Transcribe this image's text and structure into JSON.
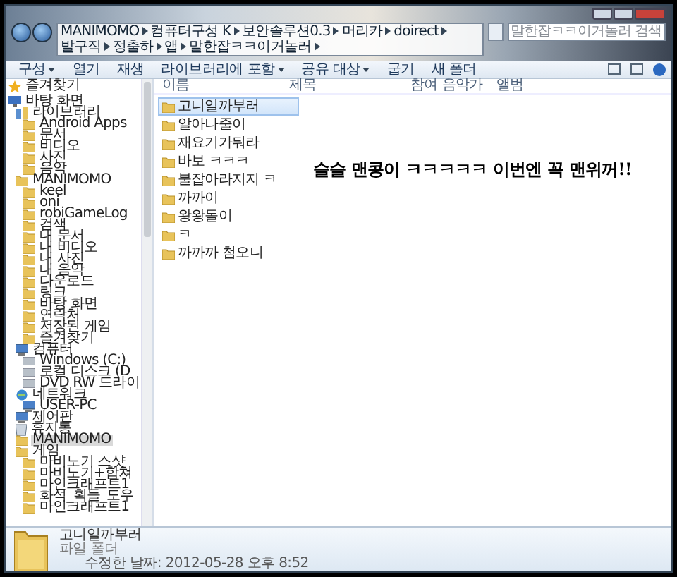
{
  "address_bar": {
    "path": [
      "MANIMOMO",
      "컴퓨터구성 K",
      "보안솔루션0.3",
      "머리카",
      "doirect",
      "발구직",
      "정출하",
      "앱",
      "말한잡ㅋㅋ이거놀러"
    ]
  },
  "search": {
    "placeholder": "말한잡ㅋㅋ이거놀러 검색"
  },
  "toolbar": [
    {
      "label": "구성",
      "dropdown": true
    },
    {
      "label": "열기",
      "dropdown": false
    },
    {
      "label": "재생",
      "dropdown": false
    },
    {
      "label": "라이브러리에 포함",
      "dropdown": true
    },
    {
      "label": "공유 대상",
      "dropdown": true
    },
    {
      "label": "굽기",
      "dropdown": false
    },
    {
      "label": "새 폴더",
      "dropdown": false
    }
  ],
  "sidebar": {
    "items": [
      {
        "label": "즐겨찾기",
        "kind": "star",
        "selected": false
      },
      {
        "label": "바탕 화면",
        "kind": "desktop",
        "selected": false,
        "children": [
          {
            "label": "라이브러리",
            "kind": "library",
            "selected": false,
            "children": [
              {
                "label": "Android Apps",
                "kind": "folder",
                "selected": false
              },
              {
                "label": "문서",
                "kind": "folder",
                "selected": false
              },
              {
                "label": "비디오",
                "kind": "folder",
                "selected": false
              },
              {
                "label": "사진",
                "kind": "folder",
                "selected": false
              },
              {
                "label": "음악",
                "kind": "folder",
                "selected": false
              }
            ]
          },
          {
            "label": "MANIMOMO",
            "kind": "folder",
            "selected": false,
            "children": [
              {
                "label": "keel",
                "kind": "folder",
                "selected": false
              },
              {
                "label": "oni",
                "kind": "folder",
                "selected": false
              },
              {
                "label": "robiGameLog",
                "kind": "folder",
                "selected": false
              },
              {
                "label": "검색",
                "kind": "folder",
                "selected": false
              },
              {
                "label": "내 문서",
                "kind": "folder",
                "selected": false
              },
              {
                "label": "내 비디오",
                "kind": "folder",
                "selected": false
              },
              {
                "label": "내 사진",
                "kind": "folder",
                "selected": false
              },
              {
                "label": "내 음악",
                "kind": "folder",
                "selected": false
              },
              {
                "label": "다운로드",
                "kind": "folder",
                "selected": false
              },
              {
                "label": "링크",
                "kind": "folder",
                "selected": false
              },
              {
                "label": "바탕 화면",
                "kind": "folder",
                "selected": false
              },
              {
                "label": "연락처",
                "kind": "folder",
                "selected": false
              },
              {
                "label": "저장된 게임",
                "kind": "folder",
                "selected": false
              },
              {
                "label": "즐겨찾기",
                "kind": "folder",
                "selected": false
              }
            ]
          },
          {
            "label": "컴퓨터",
            "kind": "computer",
            "selected": false,
            "children": [
              {
                "label": "Windows (C:)",
                "kind": "drive",
                "selected": false
              },
              {
                "label": "로컬 디스크 (D",
                "kind": "drive",
                "selected": false
              },
              {
                "label": "DVD RW 드라이",
                "kind": "drive",
                "selected": false
              }
            ]
          },
          {
            "label": "네트워크",
            "kind": "network",
            "selected": false,
            "children": [
              {
                "label": "USER-PC",
                "kind": "computer",
                "selected": false
              }
            ]
          },
          {
            "label": "제어판",
            "kind": "computer",
            "selected": false
          },
          {
            "label": "휴지통",
            "kind": "trash",
            "selected": false
          },
          {
            "label": "MANIMOMO",
            "kind": "folder",
            "selected": true
          },
          {
            "label": "게임",
            "kind": "folder",
            "selected": false,
            "children": [
              {
                "label": "마비노기 스샷",
                "kind": "folder",
                "selected": false
              },
              {
                "label": "마비노기+합쳐",
                "kind": "folder",
                "selected": false
              },
              {
                "label": "마인크래프트1",
                "kind": "folder",
                "selected": false
              },
              {
                "label": "화석_획들_도우",
                "kind": "folder",
                "selected": false
              },
              {
                "label": "마인크래프트1",
                "kind": "folder",
                "selected": false
              }
            ]
          }
        ]
      }
    ]
  },
  "table": {
    "columns": [
      "이름",
      "제목",
      "참여 음악가",
      "앨범"
    ],
    "rows": [
      {
        "name": "고니일까부러",
        "selected": true
      },
      {
        "name": "알아나줄이",
        "selected": false
      },
      {
        "name": "재요기가둬라",
        "selected": false
      },
      {
        "name": "바보 ㅋㅋㅋ",
        "selected": false
      },
      {
        "name": "불잡아라지지 ㅋ",
        "selected": false
      },
      {
        "name": "까까이",
        "selected": false
      },
      {
        "name": "왕왕돌이",
        "selected": false
      },
      {
        "name": "ㅋ",
        "selected": false
      },
      {
        "name": "까까까 첨오니",
        "selected": false
      }
    ]
  },
  "message": "슬슬 맨콩이 ㅋㅋㅋㅋㅋ 이번엔 꼭 맨위꺼!!",
  "details": {
    "name": "고니일까부러",
    "type": "파일 폴더",
    "modified": "수정한 날짜: 2012-05-28 오후 8:52"
  }
}
